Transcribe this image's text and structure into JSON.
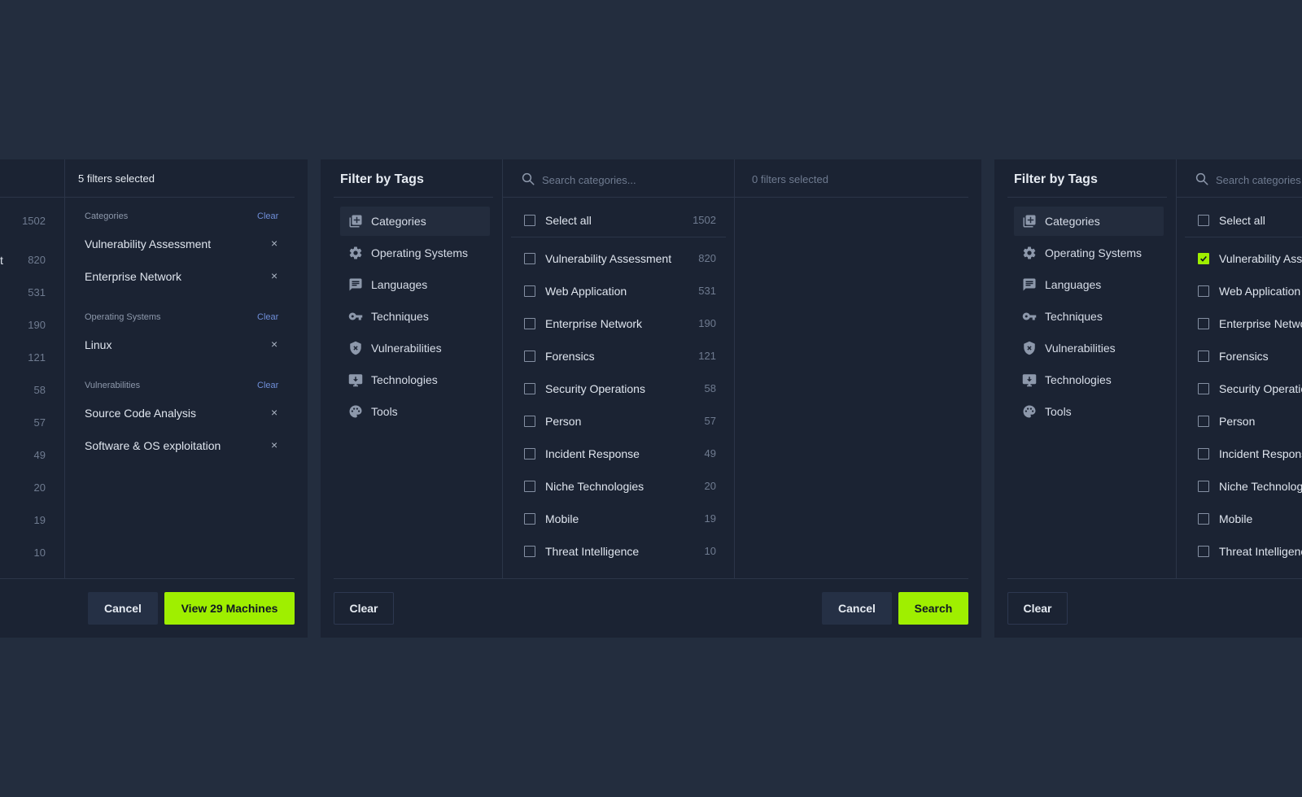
{
  "colors": {
    "background": "#232d3e",
    "panel": "#1b2333",
    "accent": "#9fef00",
    "clear_link": "#6f8ed8"
  },
  "left_panel": {
    "header": "5 filters selected",
    "counts": [
      "1502",
      "820",
      "531",
      "190",
      "121",
      "58",
      "57",
      "49",
      "20",
      "19",
      "10"
    ],
    "partial_text": "t",
    "sections": [
      {
        "label": "Categories",
        "clear": "Clear",
        "items": [
          "Vulnerability Assessment",
          "Enterprise Network"
        ]
      },
      {
        "label": "Operating Systems",
        "clear": "Clear",
        "items": [
          "Linux"
        ]
      },
      {
        "label": "Vulnerabilities",
        "clear": "Clear",
        "items": [
          "Source Code Analysis",
          "Software & OS exploitation"
        ]
      }
    ],
    "remove_glyph": "×",
    "cancel_label": "Cancel",
    "view_label": "View 29 Machines"
  },
  "mid_panel": {
    "title": "Filter by Tags",
    "search_placeholder": "Search categories...",
    "selected_header": "0 filters selected",
    "nav": [
      {
        "label": "Categories",
        "icon": "categories-icon",
        "active": true
      },
      {
        "label": "Operating Systems",
        "icon": "gear-icon"
      },
      {
        "label": "Languages",
        "icon": "chat-icon"
      },
      {
        "label": "Techniques",
        "icon": "key-icon"
      },
      {
        "label": "Vulnerabilities",
        "icon": "shield-icon"
      },
      {
        "label": "Technologies",
        "icon": "monitor-icon"
      },
      {
        "label": "Tools",
        "icon": "palette-icon"
      }
    ],
    "select_all": {
      "label": "Select all",
      "count": "1502"
    },
    "options": [
      {
        "label": "Vulnerability Assessment",
        "count": "820"
      },
      {
        "label": "Web Application",
        "count": "531"
      },
      {
        "label": "Enterprise Network",
        "count": "190"
      },
      {
        "label": "Forensics",
        "count": "121"
      },
      {
        "label": "Security Operations",
        "count": "58"
      },
      {
        "label": "Person",
        "count": "57"
      },
      {
        "label": "Incident Response",
        "count": "49"
      },
      {
        "label": "Niche Technologies",
        "count": "20"
      },
      {
        "label": "Mobile",
        "count": "19"
      },
      {
        "label": "Threat Intelligence",
        "count": "10"
      }
    ],
    "clear_label": "Clear",
    "cancel_label": "Cancel",
    "search_label": "Search"
  },
  "right_panel": {
    "title": "Filter by Tags",
    "search_placeholder": "Search categories...",
    "nav": [
      {
        "label": "Categories",
        "icon": "categories-icon",
        "active": true
      },
      {
        "label": "Operating Systems",
        "icon": "gear-icon"
      },
      {
        "label": "Languages",
        "icon": "chat-icon"
      },
      {
        "label": "Techniques",
        "icon": "key-icon"
      },
      {
        "label": "Vulnerabilities",
        "icon": "shield-icon"
      },
      {
        "label": "Technologies",
        "icon": "monitor-icon"
      },
      {
        "label": "Tools",
        "icon": "palette-icon"
      }
    ],
    "select_all": {
      "label": "Select all"
    },
    "options": [
      {
        "label": "Vulnerability Assessment",
        "checked": true
      },
      {
        "label": "Web Application"
      },
      {
        "label": "Enterprise Network"
      },
      {
        "label": "Forensics"
      },
      {
        "label": "Security Operations"
      },
      {
        "label": "Person"
      },
      {
        "label": "Incident Response"
      },
      {
        "label": "Niche Technologies"
      },
      {
        "label": "Mobile"
      },
      {
        "label": "Threat Intelligence"
      }
    ],
    "clear_label": "Clear"
  }
}
